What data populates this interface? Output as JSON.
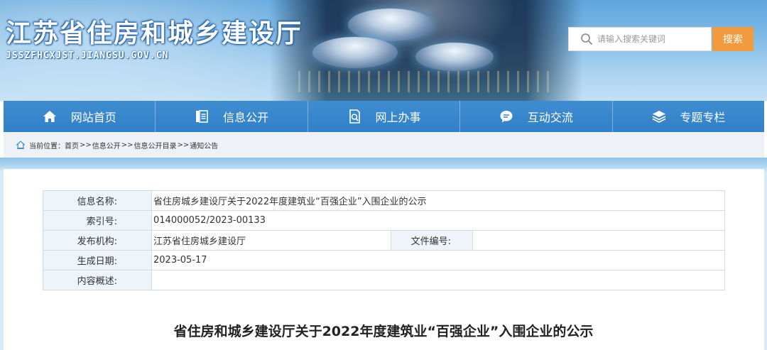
{
  "header": {
    "site_title": "江苏省住房和城乡建设厅",
    "site_domain": "JSSZFHCXJST.JIANGSU.GOV.CN",
    "search_placeholder": "请输入搜索关键词",
    "search_button": "搜索"
  },
  "nav": {
    "items": [
      {
        "label": "网站首页",
        "icon": "home-icon"
      },
      {
        "label": "信息公开",
        "icon": "document-icon"
      },
      {
        "label": "网上办事",
        "icon": "search-doc-icon"
      },
      {
        "label": "互动交流",
        "icon": "chat-icon"
      },
      {
        "label": "专题专栏",
        "icon": "layers-icon"
      }
    ]
  },
  "breadcrumb": {
    "prefix": "当前位置：",
    "items": [
      "首页",
      "信息公开",
      "信息公开目录",
      "通知公告"
    ],
    "separator": ">>"
  },
  "info": {
    "name_label": "信息名称:",
    "name_value": "省住房城乡建设厅关于2022年度建筑业“百强企业”入围企业的公示",
    "index_label": "索引号:",
    "index_value": "014000052/2023-00133",
    "org_label": "发布机构:",
    "org_value": "江苏省住房城乡建设厅",
    "file_no_label": "文件编号:",
    "file_no_value": "",
    "date_label": "生成日期:",
    "date_value": "2023-05-17",
    "summary_label": "内容概述:",
    "summary_value": ""
  },
  "document": {
    "title": "省住房和城乡建设厅关于2022年度建筑业“百强企业”入围企业的公示"
  },
  "colors": {
    "nav_bg": "#3585cb",
    "search_button": "#f19a3e",
    "label_bg": "#eef4fa",
    "breadcrumb_bg": "#eef2f6"
  }
}
